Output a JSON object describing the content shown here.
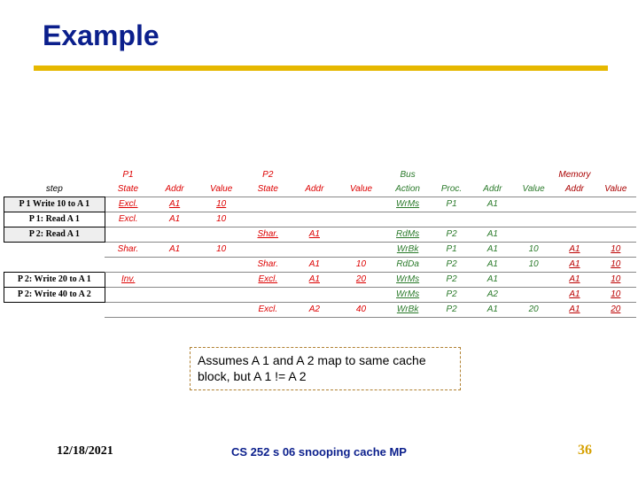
{
  "title": "Example",
  "headers": {
    "top": {
      "step": "",
      "p1": "P1",
      "p2": "P2",
      "bus": "Bus",
      "mem": "Memory"
    },
    "sub": {
      "step": "step",
      "p1_state": "State",
      "p1_addr": "Addr",
      "p1_value": "Value",
      "p2_state": "State",
      "p2_addr": "Addr",
      "p2_value": "Value",
      "bus_action": "Action",
      "bus_proc": "Proc.",
      "bus_addr": "Addr",
      "bus_value": "Value",
      "mem_addr": "Addr",
      "mem_value": "Value"
    }
  },
  "rows": [
    {
      "step": "P 1 Write 10 to A 1",
      "stepstyle": "stepbox",
      "p1_state": "Excl.",
      "p1_addr": "A1",
      "p1_value": "10",
      "p2_state": "",
      "p2_addr": "",
      "p2_value": "",
      "bus_action": "WrMs",
      "bus_proc": "P1",
      "bus_addr": "A1",
      "bus_value": "",
      "mem_addr": "",
      "mem_value": ""
    },
    {
      "step": "P 1: Read A 1",
      "stepstyle": "stepcell",
      "p1_state": "Excl.",
      "p1_addr": "A1",
      "p1_value": "10",
      "p2_state": "",
      "p2_addr": "",
      "p2_value": "",
      "bus_action": "",
      "bus_proc": "",
      "bus_addr": "",
      "bus_value": "",
      "mem_addr": "",
      "mem_value": "",
      "p1_nu": true
    },
    {
      "step": "P 2: Read A 1",
      "stepstyle": "stepbox",
      "p1_state": "",
      "p1_addr": "",
      "p1_value": "",
      "p2_state": "Shar.",
      "p2_addr": "A1",
      "p2_value": "",
      "bus_action": "RdMs",
      "bus_proc": "P2",
      "bus_addr": "A1",
      "bus_value": "",
      "mem_addr": "",
      "mem_value": ""
    },
    {
      "step": "",
      "p1_state": "Shar.",
      "p1_addr": "A1",
      "p1_value": "10",
      "p2_state": "",
      "p2_addr": "",
      "p2_value": "",
      "bus_action": "WrBk",
      "bus_proc": "P1",
      "bus_addr": "A1",
      "bus_value": "10",
      "mem_addr": "A1",
      "mem_value": "10",
      "p1_nu": true
    },
    {
      "step": "",
      "p1_state": "",
      "p1_addr": "",
      "p1_value": "",
      "p2_state": "Shar.",
      "p2_addr": "A1",
      "p2_value": "10",
      "bus_action": "RdDa",
      "bus_proc": "P2",
      "bus_addr": "A1",
      "bus_value": "10",
      "mem_addr": "A1",
      "mem_value": "10",
      "p2_nu": true,
      "bus_nu": true
    },
    {
      "step": "P 2: Write 20 to A 1",
      "stepstyle": "stepcell",
      "p1_state": "Inv.",
      "p1_addr": "",
      "p1_value": "",
      "p2_state": "Excl.",
      "p2_addr": "A1",
      "p2_value": "20",
      "bus_action": "WrMs",
      "bus_proc": "P2",
      "bus_addr": "A1",
      "bus_value": "",
      "mem_addr": "A1",
      "mem_value": "10"
    },
    {
      "step": "P 2: Write 40 to A 2",
      "stepstyle": "stepcell",
      "p1_state": "",
      "p1_addr": "",
      "p1_value": "",
      "p2_state": "",
      "p2_addr": "",
      "p2_value": "",
      "bus_action": "WrMs",
      "bus_proc": "P2",
      "bus_addr": "A2",
      "bus_value": "",
      "mem_addr": "A1",
      "mem_value": "10"
    },
    {
      "step": "",
      "p1_state": "",
      "p1_addr": "",
      "p1_value": "",
      "p2_state": "Excl.",
      "p2_addr": "A2",
      "p2_value": "40",
      "bus_action": "WrBk",
      "bus_proc": "P2",
      "bus_addr": "A1",
      "bus_value": "20",
      "mem_addr": "A1",
      "mem_value": "20",
      "p2_nu": true
    }
  ],
  "note": "Assumes A 1 and A 2 map to same cache block, but A 1 !=  A 2",
  "footer": {
    "date": "12/18/2021",
    "center": "CS 252 s 06 snooping cache MP",
    "page": "36"
  }
}
